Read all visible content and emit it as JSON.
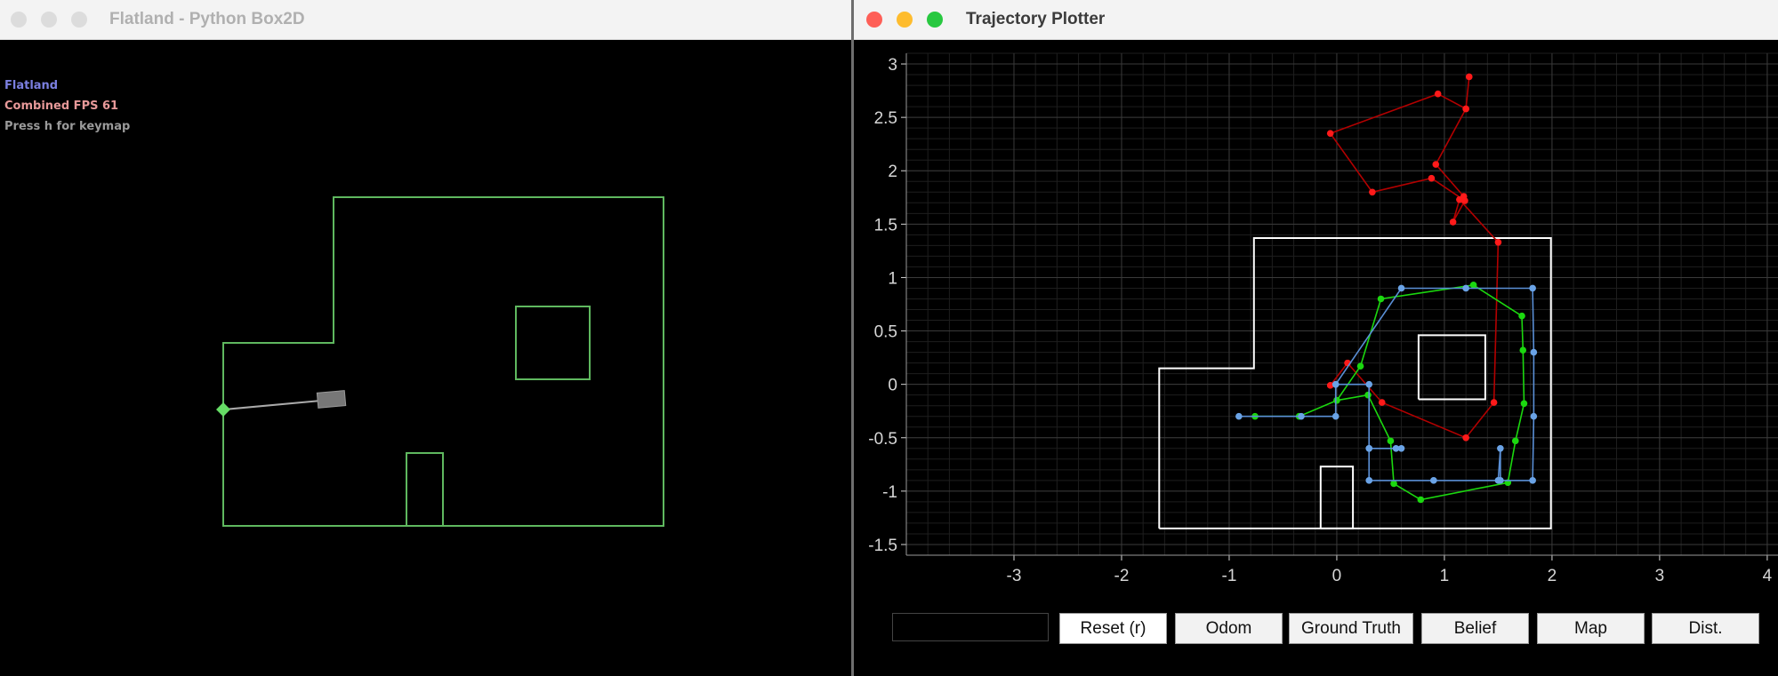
{
  "left_window": {
    "title": "Flatland - Python Box2D",
    "hud": {
      "line1": "Flatland",
      "line2": "Combined FPS 61",
      "line3": "Press h for keymap",
      "line1_color": "#7b7fe0",
      "line2_color": "#e79999",
      "line3_color": "#9a9a9a"
    },
    "wall_color": "#5fb85f",
    "robot_color": "#777777",
    "sensor_hit_color": "#66dd66"
  },
  "right_window": {
    "title": "Trajectory Plotter",
    "traffic_lights": {
      "close": "#fe5f57",
      "minimize": "#febc2e",
      "zoom": "#28c840"
    },
    "chart_data": {
      "type": "line",
      "xlim": [
        -4,
        4.1
      ],
      "ylim": [
        -1.6,
        3.1
      ],
      "xticks": [
        -3,
        -2,
        -1,
        0,
        1,
        2,
        3,
        4
      ],
      "yticks": [
        3,
        2.5,
        2,
        1.5,
        1,
        0.5,
        0,
        -0.5,
        -1,
        -1.5
      ],
      "grid": true,
      "map_outline": [
        [
          -1.65,
          -1.35
        ],
        [
          1.99,
          -1.35
        ],
        [
          1.99,
          1.37
        ],
        [
          -0.77,
          1.37
        ],
        [
          -0.77,
          0.15
        ],
        [
          -1.65,
          0.15
        ],
        [
          -1.65,
          -1.35
        ]
      ],
      "obstacles": [
        [
          [
            0.76,
            -0.14
          ],
          [
            1.38,
            -0.14
          ],
          [
            1.38,
            0.46
          ],
          [
            0.76,
            0.46
          ],
          [
            0.76,
            -0.14
          ]
        ],
        [
          [
            -0.15,
            -1.35
          ],
          [
            0.15,
            -1.35
          ],
          [
            0.15,
            -0.77
          ],
          [
            -0.15,
            -0.77
          ],
          [
            -0.15,
            -1.35
          ]
        ]
      ],
      "series": [
        {
          "color": "#ff1a1a",
          "line_color": "#b30000",
          "points": [
            [
              -0.06,
              -0.01
            ],
            [
              0.1,
              0.2
            ],
            [
              0.42,
              -0.17
            ],
            [
              1.2,
              -0.5
            ],
            [
              1.46,
              -0.17
            ],
            [
              1.5,
              1.33
            ],
            [
              1.14,
              1.73
            ],
            [
              1.08,
              1.52
            ],
            [
              1.19,
              1.72
            ],
            [
              0.88,
              1.93
            ],
            [
              0.33,
              1.8
            ],
            [
              -0.06,
              2.35
            ],
            [
              0.94,
              2.72
            ],
            [
              1.2,
              2.58
            ],
            [
              1.23,
              2.88
            ],
            [
              1.2,
              2.58
            ],
            [
              0.92,
              2.06
            ],
            [
              1.18,
              1.76
            ]
          ]
        },
        {
          "color": "#1bd80f",
          "line_color": "#1bd80f",
          "points": [
            [
              -0.76,
              -0.3
            ],
            [
              -0.35,
              -0.3
            ],
            [
              0.0,
              -0.15
            ],
            [
              0.22,
              0.17
            ],
            [
              0.41,
              0.8
            ],
            [
              1.27,
              0.93
            ],
            [
              1.72,
              0.64
            ],
            [
              1.73,
              0.32
            ],
            [
              1.74,
              -0.18
            ],
            [
              1.66,
              -0.53
            ],
            [
              1.59,
              -0.92
            ],
            [
              0.78,
              -1.08
            ],
            [
              0.53,
              -0.93
            ],
            [
              0.5,
              -0.53
            ],
            [
              0.29,
              -0.1
            ],
            [
              0.0,
              -0.15
            ]
          ]
        },
        {
          "color": "#6aa3e6",
          "line_color": "#5a8fd6",
          "points": [
            [
              -0.91,
              -0.3
            ],
            [
              -0.33,
              -0.3
            ],
            [
              -0.01,
              -0.3
            ],
            [
              -0.01,
              0.0
            ],
            [
              0.3,
              0.0
            ],
            [
              0.3,
              -0.6
            ],
            [
              0.6,
              -0.6
            ],
            [
              0.55,
              -0.6
            ],
            [
              0.3,
              -0.6
            ],
            [
              0.3,
              -0.9
            ],
            [
              0.9,
              -0.9
            ],
            [
              1.5,
              -0.9
            ],
            [
              1.52,
              -0.6
            ],
            [
              1.52,
              -0.9
            ],
            [
              1.82,
              -0.9
            ],
            [
              1.83,
              -0.3
            ],
            [
              1.83,
              0.3
            ],
            [
              1.82,
              0.9
            ],
            [
              1.2,
              0.9
            ],
            [
              0.6,
              0.9
            ],
            [
              -0.01,
              0.0
            ]
          ]
        }
      ]
    },
    "controls": {
      "input_value": "",
      "reset_label": "Reset (r)",
      "odom_label": "Odom",
      "ground_truth_label": "Ground Truth",
      "belief_label": "Belief",
      "map_label": "Map",
      "dist_label": "Dist."
    }
  }
}
